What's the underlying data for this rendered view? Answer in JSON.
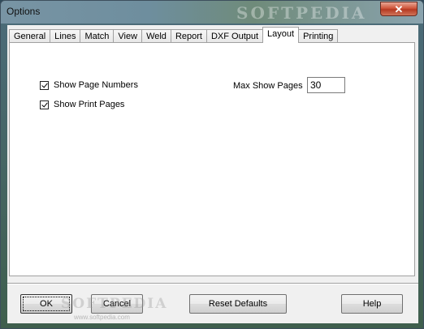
{
  "window": {
    "title": "Options",
    "close_glyph": "✕",
    "watermark": "SOFTPEDIA"
  },
  "tabs": [
    {
      "label": "General"
    },
    {
      "label": "Lines"
    },
    {
      "label": "Match"
    },
    {
      "label": "View"
    },
    {
      "label": "Weld"
    },
    {
      "label": "Report"
    },
    {
      "label": "DXF Output"
    },
    {
      "label": "Layout",
      "active": true
    },
    {
      "label": "Printing"
    }
  ],
  "layout": {
    "show_page_numbers": {
      "label": "Show Page Numbers",
      "checked": true
    },
    "show_print_pages": {
      "label": "Show Print Pages",
      "checked": true
    },
    "max_show_pages": {
      "label": "Max Show Pages",
      "value": "30"
    }
  },
  "buttons": {
    "ok": "OK",
    "cancel": "Cancel",
    "reset_defaults": "Reset Defaults",
    "help": "Help"
  },
  "footer_watermark": {
    "text": "SOFTPEDIA",
    "url": "www.softpedia.com"
  }
}
